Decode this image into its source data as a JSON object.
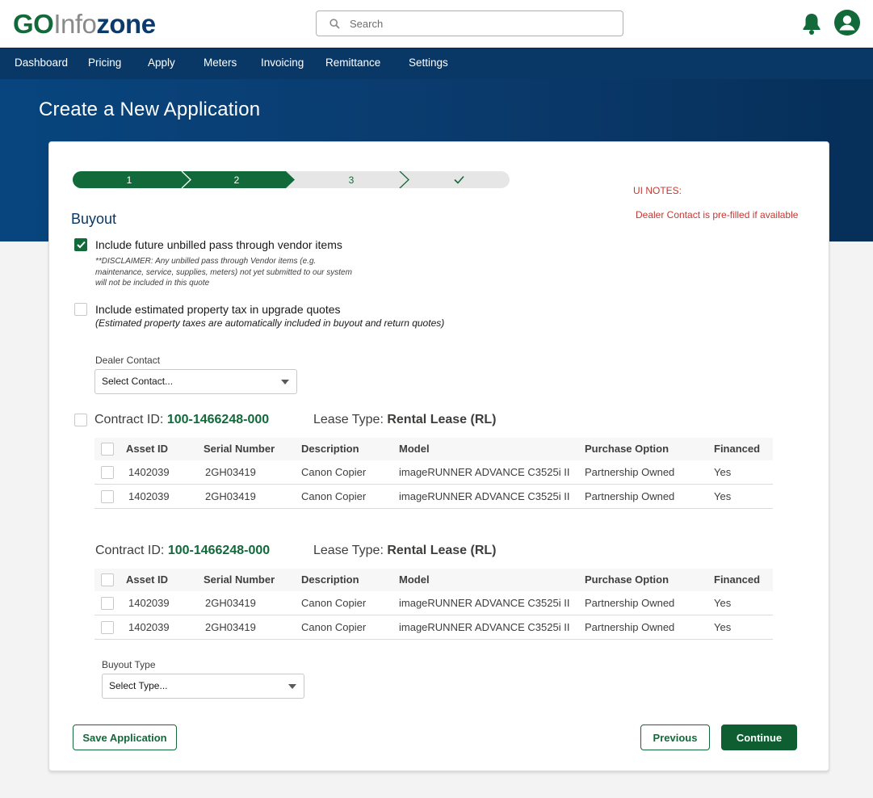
{
  "header": {
    "logo_go": "GO",
    "logo_info": "Info",
    "logo_zone": "zone",
    "search_placeholder": "Search"
  },
  "nav": {
    "items": [
      "Dashboard",
      "Pricing",
      "Apply",
      "Meters",
      "Invoicing",
      "Remittance",
      "Settings"
    ]
  },
  "page_title": "Create a New Application",
  "stepper": {
    "steps": [
      "1",
      "2",
      "3",
      "✓"
    ],
    "completed_steps": 2
  },
  "ui_notes": {
    "title": "UI NOTES:",
    "text": "Dealer Contact is pre-filled if available"
  },
  "section_title": "Buyout",
  "options": {
    "future_unbilled": {
      "label": "Include future unbilled pass through vendor items",
      "checked": true,
      "disclaimer_line1": "**DISCLAIMER: Any unbilled pass through Vendor items (e.g.",
      "disclaimer_line2": "maintenance, service, supplies, meters) not yet submitted to our system",
      "disclaimer_line3": "will not be included in this quote"
    },
    "property_tax": {
      "label": "Include estimated property tax in upgrade quotes",
      "checked": false,
      "note": "(Estimated property taxes are automatically included in buyout and return quotes)"
    }
  },
  "dealer_contact": {
    "label": "Dealer Contact",
    "value": "Select Contact..."
  },
  "contracts": [
    {
      "contract_label": "Contract ID:",
      "contract_id": "100-1466248-000",
      "lease_label": "Lease Type:",
      "lease_type": "Rental Lease (RL)",
      "columns": [
        "Asset ID",
        "Serial Number",
        "Description",
        "Model",
        "Purchase Option",
        "Financed"
      ],
      "rows": [
        [
          "1402039",
          "2GH03419",
          "Canon Copier",
          "imageRUNNER ADVANCE C3525i II",
          "Partnership Owned",
          "Yes"
        ],
        [
          "1402039",
          "2GH03419",
          "Canon Copier",
          "imageRUNNER ADVANCE C3525i II",
          "Partnership Owned",
          "Yes"
        ]
      ]
    },
    {
      "contract_label": "Contract ID:",
      "contract_id": "100-1466248-000",
      "lease_label": "Lease Type:",
      "lease_type": "Rental Lease (RL)",
      "columns": [
        "Asset ID",
        "Serial Number",
        "Description",
        "Model",
        "Purchase Option",
        "Financed"
      ],
      "rows": [
        [
          "1402039",
          "2GH03419",
          "Canon Copier",
          "imageRUNNER ADVANCE C3525i II",
          "Partnership Owned",
          "Yes"
        ],
        [
          "1402039",
          "2GH03419",
          "Canon Copier",
          "imageRUNNER ADVANCE C3525i II",
          "Partnership Owned",
          "Yes"
        ]
      ]
    }
  ],
  "buyout_type": {
    "label": "Buyout Type",
    "value": "Select Type..."
  },
  "buttons": {
    "save": "Save Application",
    "previous": "Previous",
    "continue": "Continue"
  },
  "colors": {
    "brand_green": "#12693a",
    "nav_blue": "#0a3866",
    "note_red": "#c23934"
  }
}
